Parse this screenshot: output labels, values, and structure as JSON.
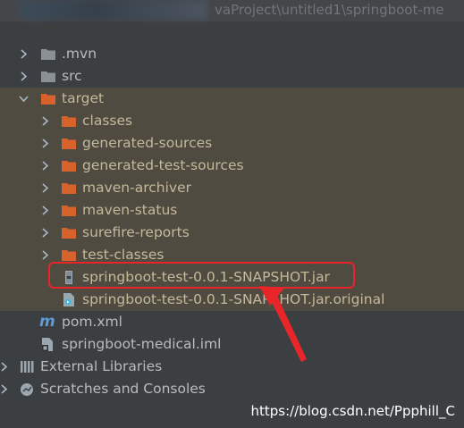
{
  "header": {
    "path_text": "vaProject\\untitled1\\springboot-me"
  },
  "tree": {
    "items": [
      {
        "label": ".mvn",
        "icon": "folder-icon"
      },
      {
        "label": "src",
        "icon": "folder-icon"
      },
      {
        "label": "target",
        "icon": "excluded-folder-icon"
      },
      {
        "label": "classes",
        "icon": "excluded-folder-icon"
      },
      {
        "label": "generated-sources",
        "icon": "excluded-folder-icon"
      },
      {
        "label": "generated-test-sources",
        "icon": "excluded-folder-icon"
      },
      {
        "label": "maven-archiver",
        "icon": "excluded-folder-icon"
      },
      {
        "label": "maven-status",
        "icon": "excluded-folder-icon"
      },
      {
        "label": "surefire-reports",
        "icon": "excluded-folder-icon"
      },
      {
        "label": "test-classes",
        "icon": "excluded-folder-icon"
      },
      {
        "label": "springboot-test-0.0.1-SNAPSHOT.jar",
        "icon": "jar-icon"
      },
      {
        "label": "springboot-test-0.0.1-SNAPSHOT.jar.original",
        "icon": "file-icon"
      },
      {
        "label": "pom.xml",
        "icon": "maven-icon"
      },
      {
        "label": "springboot-medical.iml",
        "icon": "iml-icon"
      },
      {
        "label": "External Libraries",
        "icon": "libraries-icon"
      },
      {
        "label": "Scratches and Consoles",
        "icon": "scratches-icon"
      }
    ]
  },
  "annotation": {
    "box_color": "#e8262a"
  },
  "watermark": "https://blog.csdn.net/Ppphill_C",
  "colors": {
    "background": "#3c3f41",
    "excluded_row": "#4f4b41",
    "folder": "#8b9096",
    "excluded_folder": "#d7622b"
  }
}
